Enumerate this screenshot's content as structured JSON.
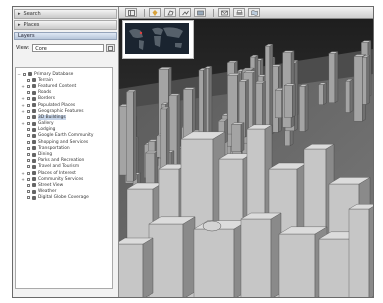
{
  "sidebar": {
    "search_panel": "Search",
    "places_panel": "Places",
    "layers_panel": "Layers",
    "view_label": "View:",
    "view_value": "Core",
    "layer_items": [
      {
        "label": "Primary Database",
        "level": 0,
        "expander": "minus"
      },
      {
        "label": "Terrain",
        "level": 1
      },
      {
        "label": "Featured Content",
        "level": 1,
        "expander": "plus"
      },
      {
        "label": "Roads",
        "level": 1
      },
      {
        "label": "Borders",
        "level": 1,
        "expander": "plus"
      },
      {
        "label": "Populated Places",
        "level": 1,
        "expander": "plus"
      },
      {
        "label": "Geographic Features",
        "level": 1,
        "expander": "plus"
      },
      {
        "label": "3D Buildings",
        "level": 1,
        "selected": true
      },
      {
        "label": "Gallery",
        "level": 1,
        "expander": "plus"
      },
      {
        "label": "Lodging",
        "level": 1
      },
      {
        "label": "Google Earth Community",
        "level": 1
      },
      {
        "label": "Shopping and Services",
        "level": 1
      },
      {
        "label": "Transportation",
        "level": 1
      },
      {
        "label": "Dining",
        "level": 1
      },
      {
        "label": "Parks and Recreation",
        "level": 1
      },
      {
        "label": "Travel and Tourism",
        "level": 1
      },
      {
        "label": "Places of Interest",
        "level": 1,
        "expander": "plus"
      },
      {
        "label": "Community Services",
        "level": 1,
        "expander": "plus"
      },
      {
        "label": "Street View",
        "level": 1
      },
      {
        "label": "Weather",
        "level": 1
      },
      {
        "label": "Digital Globe Coverage",
        "level": 1
      }
    ]
  },
  "toolbar": {
    "icons": [
      "sidebar-toggle-icon",
      "placemark-icon",
      "polygon-icon",
      "path-icon",
      "overlay-icon",
      "email-icon",
      "print-icon",
      "maps-icon"
    ]
  },
  "colors": {
    "sky": "#2c2c2c",
    "building_light": "#c8c8c8",
    "building_shade": "#8a8a8a",
    "ground": "#6a6a6a"
  }
}
